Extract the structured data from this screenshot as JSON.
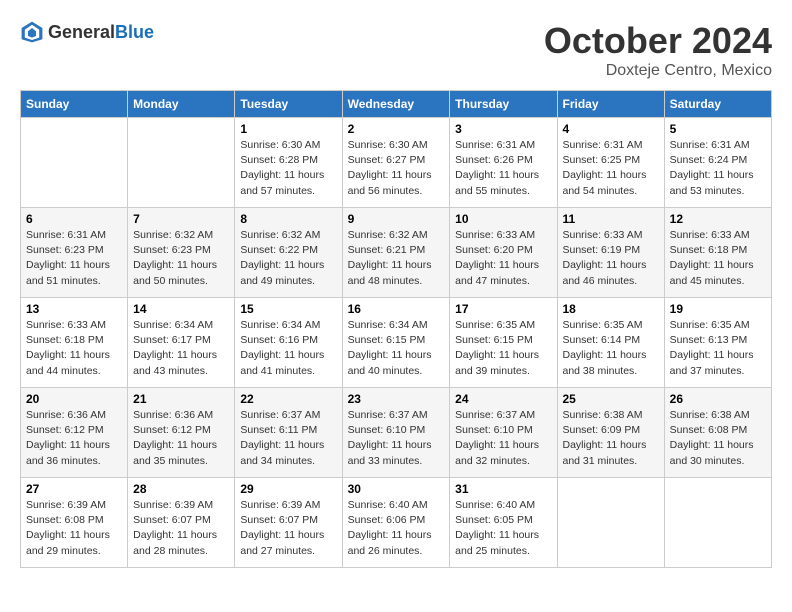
{
  "header": {
    "logo_general": "General",
    "logo_blue": "Blue",
    "month": "October 2024",
    "location": "Doxteje Centro, Mexico"
  },
  "days_of_week": [
    "Sunday",
    "Monday",
    "Tuesday",
    "Wednesday",
    "Thursday",
    "Friday",
    "Saturday"
  ],
  "weeks": [
    [
      {
        "day": "",
        "sunrise": "",
        "sunset": "",
        "daylight": ""
      },
      {
        "day": "",
        "sunrise": "",
        "sunset": "",
        "daylight": ""
      },
      {
        "day": "1",
        "sunrise": "Sunrise: 6:30 AM",
        "sunset": "Sunset: 6:28 PM",
        "daylight": "Daylight: 11 hours and 57 minutes."
      },
      {
        "day": "2",
        "sunrise": "Sunrise: 6:30 AM",
        "sunset": "Sunset: 6:27 PM",
        "daylight": "Daylight: 11 hours and 56 minutes."
      },
      {
        "day": "3",
        "sunrise": "Sunrise: 6:31 AM",
        "sunset": "Sunset: 6:26 PM",
        "daylight": "Daylight: 11 hours and 55 minutes."
      },
      {
        "day": "4",
        "sunrise": "Sunrise: 6:31 AM",
        "sunset": "Sunset: 6:25 PM",
        "daylight": "Daylight: 11 hours and 54 minutes."
      },
      {
        "day": "5",
        "sunrise": "Sunrise: 6:31 AM",
        "sunset": "Sunset: 6:24 PM",
        "daylight": "Daylight: 11 hours and 53 minutes."
      }
    ],
    [
      {
        "day": "6",
        "sunrise": "Sunrise: 6:31 AM",
        "sunset": "Sunset: 6:23 PM",
        "daylight": "Daylight: 11 hours and 51 minutes."
      },
      {
        "day": "7",
        "sunrise": "Sunrise: 6:32 AM",
        "sunset": "Sunset: 6:23 PM",
        "daylight": "Daylight: 11 hours and 50 minutes."
      },
      {
        "day": "8",
        "sunrise": "Sunrise: 6:32 AM",
        "sunset": "Sunset: 6:22 PM",
        "daylight": "Daylight: 11 hours and 49 minutes."
      },
      {
        "day": "9",
        "sunrise": "Sunrise: 6:32 AM",
        "sunset": "Sunset: 6:21 PM",
        "daylight": "Daylight: 11 hours and 48 minutes."
      },
      {
        "day": "10",
        "sunrise": "Sunrise: 6:33 AM",
        "sunset": "Sunset: 6:20 PM",
        "daylight": "Daylight: 11 hours and 47 minutes."
      },
      {
        "day": "11",
        "sunrise": "Sunrise: 6:33 AM",
        "sunset": "Sunset: 6:19 PM",
        "daylight": "Daylight: 11 hours and 46 minutes."
      },
      {
        "day": "12",
        "sunrise": "Sunrise: 6:33 AM",
        "sunset": "Sunset: 6:18 PM",
        "daylight": "Daylight: 11 hours and 45 minutes."
      }
    ],
    [
      {
        "day": "13",
        "sunrise": "Sunrise: 6:33 AM",
        "sunset": "Sunset: 6:18 PM",
        "daylight": "Daylight: 11 hours and 44 minutes."
      },
      {
        "day": "14",
        "sunrise": "Sunrise: 6:34 AM",
        "sunset": "Sunset: 6:17 PM",
        "daylight": "Daylight: 11 hours and 43 minutes."
      },
      {
        "day": "15",
        "sunrise": "Sunrise: 6:34 AM",
        "sunset": "Sunset: 6:16 PM",
        "daylight": "Daylight: 11 hours and 41 minutes."
      },
      {
        "day": "16",
        "sunrise": "Sunrise: 6:34 AM",
        "sunset": "Sunset: 6:15 PM",
        "daylight": "Daylight: 11 hours and 40 minutes."
      },
      {
        "day": "17",
        "sunrise": "Sunrise: 6:35 AM",
        "sunset": "Sunset: 6:15 PM",
        "daylight": "Daylight: 11 hours and 39 minutes."
      },
      {
        "day": "18",
        "sunrise": "Sunrise: 6:35 AM",
        "sunset": "Sunset: 6:14 PM",
        "daylight": "Daylight: 11 hours and 38 minutes."
      },
      {
        "day": "19",
        "sunrise": "Sunrise: 6:35 AM",
        "sunset": "Sunset: 6:13 PM",
        "daylight": "Daylight: 11 hours and 37 minutes."
      }
    ],
    [
      {
        "day": "20",
        "sunrise": "Sunrise: 6:36 AM",
        "sunset": "Sunset: 6:12 PM",
        "daylight": "Daylight: 11 hours and 36 minutes."
      },
      {
        "day": "21",
        "sunrise": "Sunrise: 6:36 AM",
        "sunset": "Sunset: 6:12 PM",
        "daylight": "Daylight: 11 hours and 35 minutes."
      },
      {
        "day": "22",
        "sunrise": "Sunrise: 6:37 AM",
        "sunset": "Sunset: 6:11 PM",
        "daylight": "Daylight: 11 hours and 34 minutes."
      },
      {
        "day": "23",
        "sunrise": "Sunrise: 6:37 AM",
        "sunset": "Sunset: 6:10 PM",
        "daylight": "Daylight: 11 hours and 33 minutes."
      },
      {
        "day": "24",
        "sunrise": "Sunrise: 6:37 AM",
        "sunset": "Sunset: 6:10 PM",
        "daylight": "Daylight: 11 hours and 32 minutes."
      },
      {
        "day": "25",
        "sunrise": "Sunrise: 6:38 AM",
        "sunset": "Sunset: 6:09 PM",
        "daylight": "Daylight: 11 hours and 31 minutes."
      },
      {
        "day": "26",
        "sunrise": "Sunrise: 6:38 AM",
        "sunset": "Sunset: 6:08 PM",
        "daylight": "Daylight: 11 hours and 30 minutes."
      }
    ],
    [
      {
        "day": "27",
        "sunrise": "Sunrise: 6:39 AM",
        "sunset": "Sunset: 6:08 PM",
        "daylight": "Daylight: 11 hours and 29 minutes."
      },
      {
        "day": "28",
        "sunrise": "Sunrise: 6:39 AM",
        "sunset": "Sunset: 6:07 PM",
        "daylight": "Daylight: 11 hours and 28 minutes."
      },
      {
        "day": "29",
        "sunrise": "Sunrise: 6:39 AM",
        "sunset": "Sunset: 6:07 PM",
        "daylight": "Daylight: 11 hours and 27 minutes."
      },
      {
        "day": "30",
        "sunrise": "Sunrise: 6:40 AM",
        "sunset": "Sunset: 6:06 PM",
        "daylight": "Daylight: 11 hours and 26 minutes."
      },
      {
        "day": "31",
        "sunrise": "Sunrise: 6:40 AM",
        "sunset": "Sunset: 6:05 PM",
        "daylight": "Daylight: 11 hours and 25 minutes."
      },
      {
        "day": "",
        "sunrise": "",
        "sunset": "",
        "daylight": ""
      },
      {
        "day": "",
        "sunrise": "",
        "sunset": "",
        "daylight": ""
      }
    ]
  ]
}
